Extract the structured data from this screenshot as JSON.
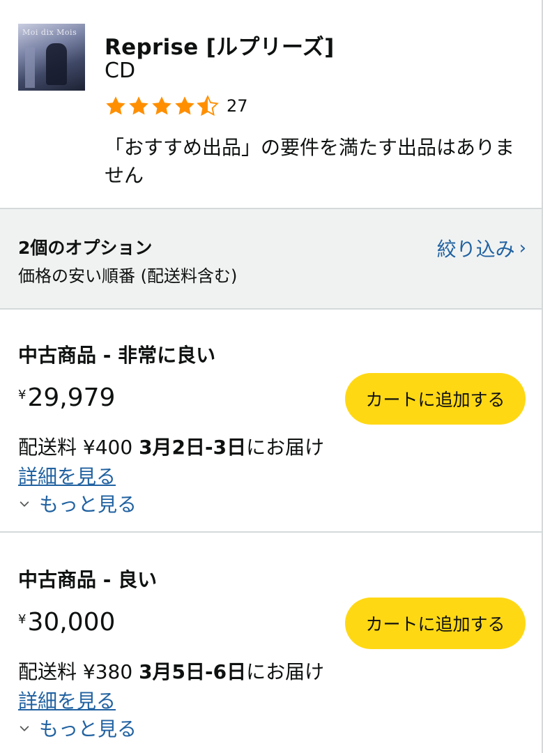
{
  "product": {
    "title": "Reprise [ルプリーズ]",
    "format": "CD",
    "rating": 4.5,
    "rating_count": "27",
    "no_featured_offer": "「おすすめ出品」の要件を満たす出品はありません",
    "star_color": "#ff8f00",
    "thumbnail_text": "Moi dix Mois"
  },
  "options": {
    "title": "2個のオプション",
    "sort": "価格の安い順番 (配送料含む)",
    "filter_label": "絞り込み",
    "filter_chevron": "›",
    "link_color": "#2162a1"
  },
  "offers": [
    {
      "condition": "中古商品 - 非常に良い",
      "currency": "¥",
      "price": "29,979",
      "cart_label": "カートに追加する",
      "shipping": "配送料 ¥400 ",
      "delivery_date": "3月2日-3日",
      "delivery_suffix": "にお届け",
      "details_label": "詳細を見る",
      "more_label": "もっと見る"
    },
    {
      "condition": "中古商品 - 良い",
      "currency": "¥",
      "price": "30,000",
      "cart_label": "カートに追加する",
      "shipping": "配送料 ¥380 ",
      "delivery_date": "3月5日-6日",
      "delivery_suffix": "にお届け",
      "details_label": "詳細を見る",
      "more_label": "もっと見る"
    }
  ],
  "colors": {
    "cart_button": "#ffd814",
    "options_bg": "#f0f2f2"
  }
}
